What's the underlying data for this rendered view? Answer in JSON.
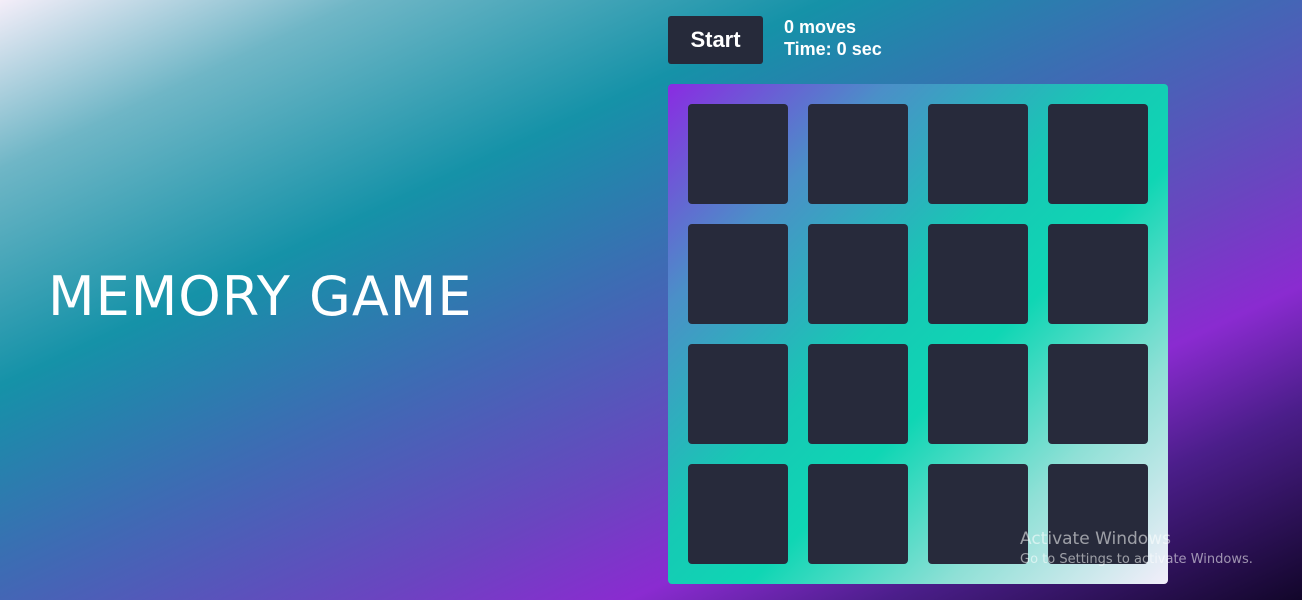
{
  "title": "MEMORY GAME",
  "controls": {
    "start_label": "Start",
    "moves_text": "0 moves",
    "time_text": "Time: 0 sec"
  },
  "board": {
    "rows": 4,
    "columns": 4,
    "card_count": 16,
    "card_state": "face-down"
  },
  "watermark": {
    "title": "Activate Windows",
    "subtitle": "Go to Settings to activate Windows."
  },
  "colors": {
    "card": "#272a3b",
    "button": "#262a3a",
    "text": "#ffffff"
  }
}
